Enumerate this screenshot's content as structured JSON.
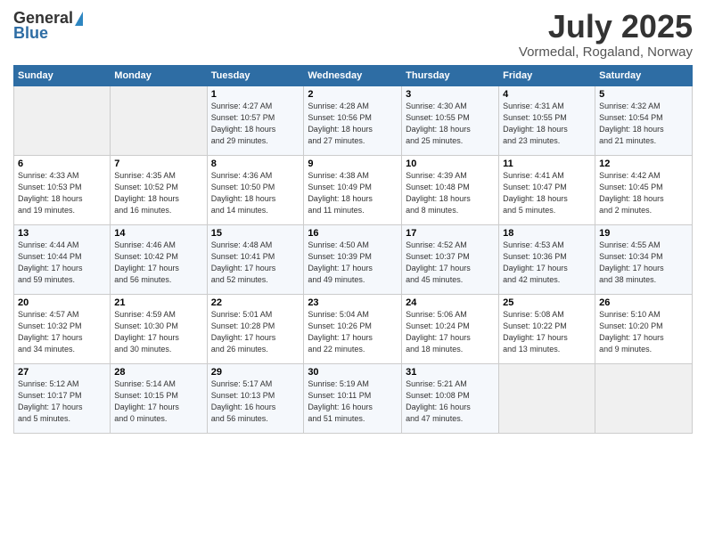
{
  "header": {
    "logo_general": "General",
    "logo_blue": "Blue",
    "month": "July 2025",
    "location": "Vormedal, Rogaland, Norway"
  },
  "days_of_week": [
    "Sunday",
    "Monday",
    "Tuesday",
    "Wednesday",
    "Thursday",
    "Friday",
    "Saturday"
  ],
  "weeks": [
    [
      {
        "num": "",
        "info": ""
      },
      {
        "num": "",
        "info": ""
      },
      {
        "num": "1",
        "info": "Sunrise: 4:27 AM\nSunset: 10:57 PM\nDaylight: 18 hours\nand 29 minutes."
      },
      {
        "num": "2",
        "info": "Sunrise: 4:28 AM\nSunset: 10:56 PM\nDaylight: 18 hours\nand 27 minutes."
      },
      {
        "num": "3",
        "info": "Sunrise: 4:30 AM\nSunset: 10:55 PM\nDaylight: 18 hours\nand 25 minutes."
      },
      {
        "num": "4",
        "info": "Sunrise: 4:31 AM\nSunset: 10:55 PM\nDaylight: 18 hours\nand 23 minutes."
      },
      {
        "num": "5",
        "info": "Sunrise: 4:32 AM\nSunset: 10:54 PM\nDaylight: 18 hours\nand 21 minutes."
      }
    ],
    [
      {
        "num": "6",
        "info": "Sunrise: 4:33 AM\nSunset: 10:53 PM\nDaylight: 18 hours\nand 19 minutes."
      },
      {
        "num": "7",
        "info": "Sunrise: 4:35 AM\nSunset: 10:52 PM\nDaylight: 18 hours\nand 16 minutes."
      },
      {
        "num": "8",
        "info": "Sunrise: 4:36 AM\nSunset: 10:50 PM\nDaylight: 18 hours\nand 14 minutes."
      },
      {
        "num": "9",
        "info": "Sunrise: 4:38 AM\nSunset: 10:49 PM\nDaylight: 18 hours\nand 11 minutes."
      },
      {
        "num": "10",
        "info": "Sunrise: 4:39 AM\nSunset: 10:48 PM\nDaylight: 18 hours\nand 8 minutes."
      },
      {
        "num": "11",
        "info": "Sunrise: 4:41 AM\nSunset: 10:47 PM\nDaylight: 18 hours\nand 5 minutes."
      },
      {
        "num": "12",
        "info": "Sunrise: 4:42 AM\nSunset: 10:45 PM\nDaylight: 18 hours\nand 2 minutes."
      }
    ],
    [
      {
        "num": "13",
        "info": "Sunrise: 4:44 AM\nSunset: 10:44 PM\nDaylight: 17 hours\nand 59 minutes."
      },
      {
        "num": "14",
        "info": "Sunrise: 4:46 AM\nSunset: 10:42 PM\nDaylight: 17 hours\nand 56 minutes."
      },
      {
        "num": "15",
        "info": "Sunrise: 4:48 AM\nSunset: 10:41 PM\nDaylight: 17 hours\nand 52 minutes."
      },
      {
        "num": "16",
        "info": "Sunrise: 4:50 AM\nSunset: 10:39 PM\nDaylight: 17 hours\nand 49 minutes."
      },
      {
        "num": "17",
        "info": "Sunrise: 4:52 AM\nSunset: 10:37 PM\nDaylight: 17 hours\nand 45 minutes."
      },
      {
        "num": "18",
        "info": "Sunrise: 4:53 AM\nSunset: 10:36 PM\nDaylight: 17 hours\nand 42 minutes."
      },
      {
        "num": "19",
        "info": "Sunrise: 4:55 AM\nSunset: 10:34 PM\nDaylight: 17 hours\nand 38 minutes."
      }
    ],
    [
      {
        "num": "20",
        "info": "Sunrise: 4:57 AM\nSunset: 10:32 PM\nDaylight: 17 hours\nand 34 minutes."
      },
      {
        "num": "21",
        "info": "Sunrise: 4:59 AM\nSunset: 10:30 PM\nDaylight: 17 hours\nand 30 minutes."
      },
      {
        "num": "22",
        "info": "Sunrise: 5:01 AM\nSunset: 10:28 PM\nDaylight: 17 hours\nand 26 minutes."
      },
      {
        "num": "23",
        "info": "Sunrise: 5:04 AM\nSunset: 10:26 PM\nDaylight: 17 hours\nand 22 minutes."
      },
      {
        "num": "24",
        "info": "Sunrise: 5:06 AM\nSunset: 10:24 PM\nDaylight: 17 hours\nand 18 minutes."
      },
      {
        "num": "25",
        "info": "Sunrise: 5:08 AM\nSunset: 10:22 PM\nDaylight: 17 hours\nand 13 minutes."
      },
      {
        "num": "26",
        "info": "Sunrise: 5:10 AM\nSunset: 10:20 PM\nDaylight: 17 hours\nand 9 minutes."
      }
    ],
    [
      {
        "num": "27",
        "info": "Sunrise: 5:12 AM\nSunset: 10:17 PM\nDaylight: 17 hours\nand 5 minutes."
      },
      {
        "num": "28",
        "info": "Sunrise: 5:14 AM\nSunset: 10:15 PM\nDaylight: 17 hours\nand 0 minutes."
      },
      {
        "num": "29",
        "info": "Sunrise: 5:17 AM\nSunset: 10:13 PM\nDaylight: 16 hours\nand 56 minutes."
      },
      {
        "num": "30",
        "info": "Sunrise: 5:19 AM\nSunset: 10:11 PM\nDaylight: 16 hours\nand 51 minutes."
      },
      {
        "num": "31",
        "info": "Sunrise: 5:21 AM\nSunset: 10:08 PM\nDaylight: 16 hours\nand 47 minutes."
      },
      {
        "num": "",
        "info": ""
      },
      {
        "num": "",
        "info": ""
      }
    ]
  ]
}
